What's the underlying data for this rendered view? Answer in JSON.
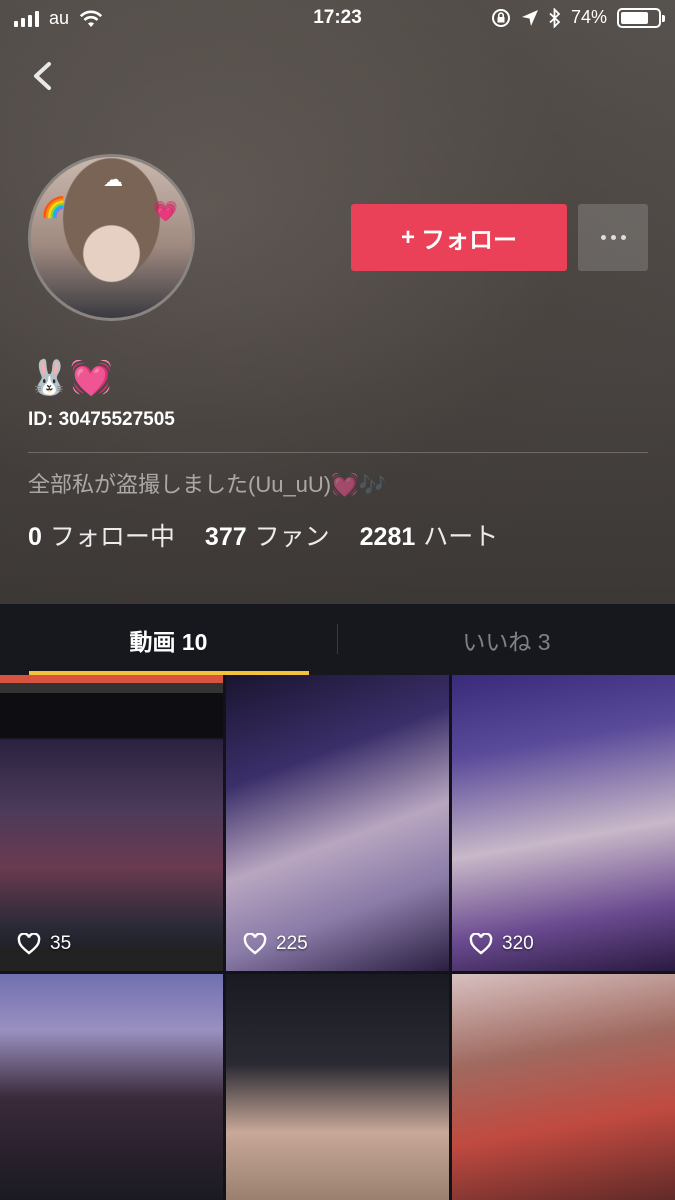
{
  "status_bar": {
    "carrier": "au",
    "time": "17:23",
    "battery": "74%",
    "battery_level": 0.74
  },
  "profile": {
    "nickname": "🐰💓",
    "id_text": "ID: 30475527505",
    "bio": "全部私が盗撮しました(Uu_uU)💓🎶",
    "follow_button": "フォロー",
    "follow_plus": "+",
    "stats": [
      {
        "value": "0",
        "label": "フォロー中"
      },
      {
        "value": "377",
        "label": "ファン"
      },
      {
        "value": "2281",
        "label": "ハート"
      }
    ]
  },
  "tabs": [
    {
      "label": "動画 10",
      "active": true
    },
    {
      "label": "いいね 3",
      "active": false
    }
  ],
  "accent_colors": {
    "follow_button": "#ea4158",
    "tab_underline": "#f3c33b"
  },
  "videos": [
    {
      "likes": "35"
    },
    {
      "likes": "225"
    },
    {
      "likes": "320"
    },
    {
      "likes": ""
    },
    {
      "likes": ""
    },
    {
      "likes": ""
    }
  ]
}
